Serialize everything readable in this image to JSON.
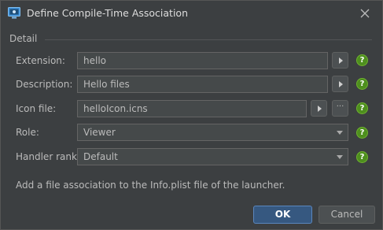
{
  "window": {
    "title": "Define Compile-Time Association",
    "icon": "app-window-icon",
    "close_icon": "close-icon"
  },
  "section": {
    "label": "Detail"
  },
  "fields": {
    "extension": {
      "label": "Extension:",
      "value": "hello"
    },
    "description": {
      "label": "Description:",
      "value": "Hello files"
    },
    "icon_file": {
      "label": "Icon file:",
      "value": "helloIcon.icns"
    },
    "role": {
      "label": "Role:",
      "value": "Viewer"
    },
    "handler_rank": {
      "label": "Handler rank:",
      "value": "Default"
    }
  },
  "help_glyph": "?",
  "browse_glyph": "···",
  "hint": "Add a file association to the Info.plist file of the launcher.",
  "buttons": {
    "ok": "OK",
    "cancel": "Cancel"
  },
  "colors": {
    "background": "#3c3f41",
    "field_bg": "#45494a",
    "accent": "#365880",
    "help_green": "#4e8f1e"
  }
}
